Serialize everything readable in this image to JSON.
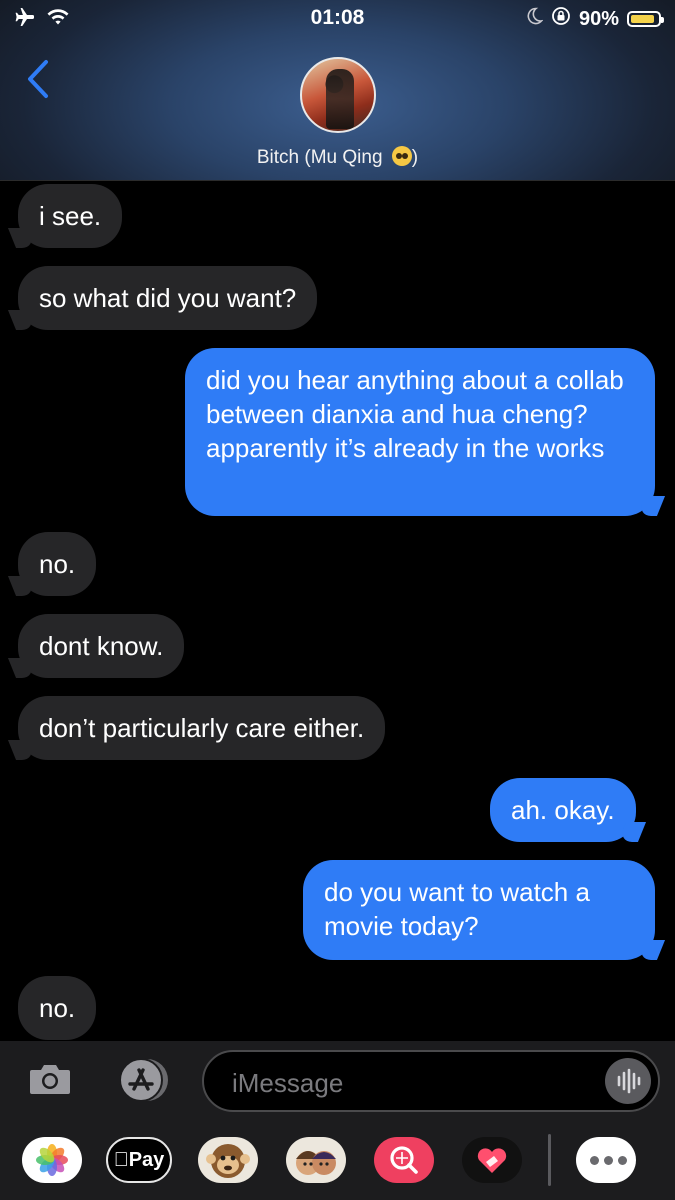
{
  "status_bar": {
    "time": "01:08",
    "battery_percent": "90%",
    "battery_level": 0.9
  },
  "header": {
    "contact_name": "Bitch (Mu Qing",
    "contact_name_close": ")",
    "name_emoji": "pleading-face"
  },
  "messages": [
    {
      "from": "them",
      "text": "i see."
    },
    {
      "from": "them",
      "text": "so what did you want?"
    },
    {
      "from": "me",
      "text": "did you hear anything about a collab between dianxia and hua cheng? apparently it’s already in the works"
    },
    {
      "from": "them",
      "text": "no."
    },
    {
      "from": "them",
      "text": "dont know."
    },
    {
      "from": "them",
      "text": "don’t particularly care either."
    },
    {
      "from": "me",
      "text": "ah. okay."
    },
    {
      "from": "me",
      "text": "do you want to watch a movie today?"
    },
    {
      "from": "them",
      "text": "no."
    }
  ],
  "input": {
    "placeholder": "iMessage"
  },
  "app_tray": {
    "apple_pay_label": "Pay"
  },
  "colors": {
    "incoming_bubble": "#262628",
    "outgoing_bubble": "#2f7cf6",
    "background": "#000000"
  }
}
